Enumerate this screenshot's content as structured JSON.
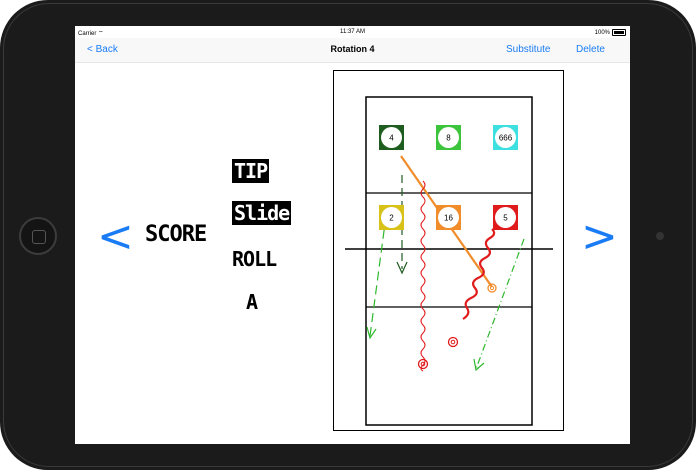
{
  "status": {
    "carrier": "Carrier",
    "time": "11:37 AM",
    "battery": "100%"
  },
  "nav": {
    "back_label": "< Back",
    "title": "Rotation 4",
    "substitute_label": "Substitute",
    "delete_label": "Delete"
  },
  "arrows": {
    "prev": "<",
    "next": ">"
  },
  "score_label": "SCORE",
  "plays": [
    "TIP",
    "Slide",
    "ROLL",
    "A"
  ],
  "players": [
    {
      "number": "4",
      "color": "#1f5c1f"
    },
    {
      "number": "8",
      "color": "#3cc43c"
    },
    {
      "number": "666",
      "color": "#3ce0e0"
    },
    {
      "number": "2",
      "color": "#d8c21a"
    },
    {
      "number": "16",
      "color": "#f08c2a"
    },
    {
      "number": "5",
      "color": "#e01b1b"
    }
  ],
  "colors": {
    "accent": "#1a7cf5",
    "orange_path": "#f08c2a",
    "red_path": "#e01b1b",
    "green_path": "#2eb82e",
    "dark_green_path": "#1f5c1f"
  }
}
